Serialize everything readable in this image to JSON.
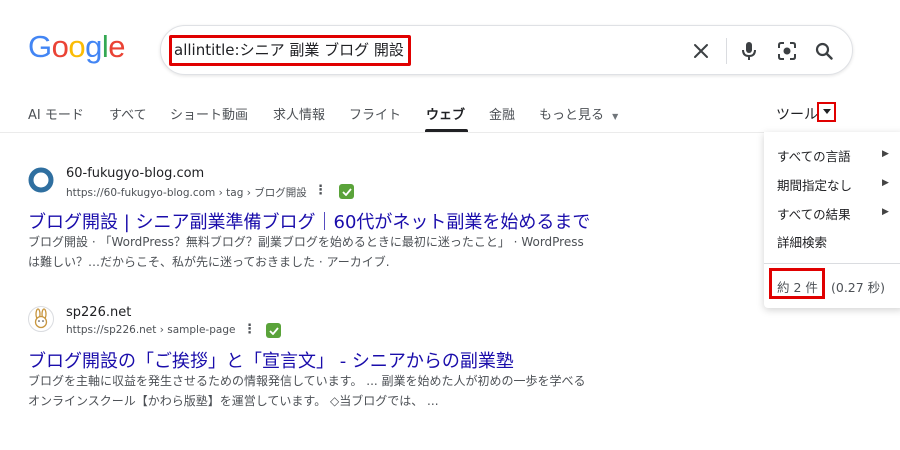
{
  "logo": {
    "letters": [
      "G",
      "o",
      "o",
      "g",
      "l",
      "e"
    ],
    "colors": [
      "#4285F4",
      "#EA4335",
      "#FBBC05",
      "#4285F4",
      "#34A853",
      "#EA4335"
    ]
  },
  "search": {
    "query": "allintitle:シニア 副業 ブログ 開設"
  },
  "tabs": [
    {
      "label": "AI モード"
    },
    {
      "label": "すべて"
    },
    {
      "label": "ショート動画"
    },
    {
      "label": "求人情報"
    },
    {
      "label": "フライト"
    },
    {
      "label": "ウェブ"
    },
    {
      "label": "金融"
    },
    {
      "label": "もっと見る"
    }
  ],
  "tools": {
    "label": "ツール"
  },
  "tools_menu": {
    "items": [
      {
        "label": "すべての言語"
      },
      {
        "label": "期間指定なし"
      },
      {
        "label": "すべての結果"
      },
      {
        "label": "詳細検索"
      }
    ],
    "result_count": "約 2 件",
    "result_time": "(0.27 秒)"
  },
  "results": [
    {
      "site_name": "60-fukugyo-blog.com",
      "url": "https://60-fukugyo-blog.com › tag › ブログ開設",
      "title": "ブログ開設 | シニア副業準備ブログ｜60代がネット副業を始めるまで",
      "snippet_lines": [
        "ブログ開設 · 「WordPress？無料ブログ？副業ブログを始めるときに最初に迷ったこと」 · WordPress",
        "は難しい？…だからこそ、私が先に迷っておきました · アーカイブ."
      ]
    },
    {
      "site_name": "sp226.net",
      "url": "https://sp226.net › sample-page",
      "title": "ブログ開設の「ご挨拶」と「宣言文」 - シニアからの副業塾",
      "snippet_lines": [
        "ブログを主軸に収益を発生させるための情報発信しています。 ... 副業を始めた人が初めの一歩を学べる",
        "オンラインスクール【かわら版塾】を運営しています。 ◇当ブログでは、 ..."
      ]
    }
  ],
  "colors": {
    "highlight": "#e00000",
    "link": "#1a0dab",
    "verified": "#5aa33a"
  }
}
